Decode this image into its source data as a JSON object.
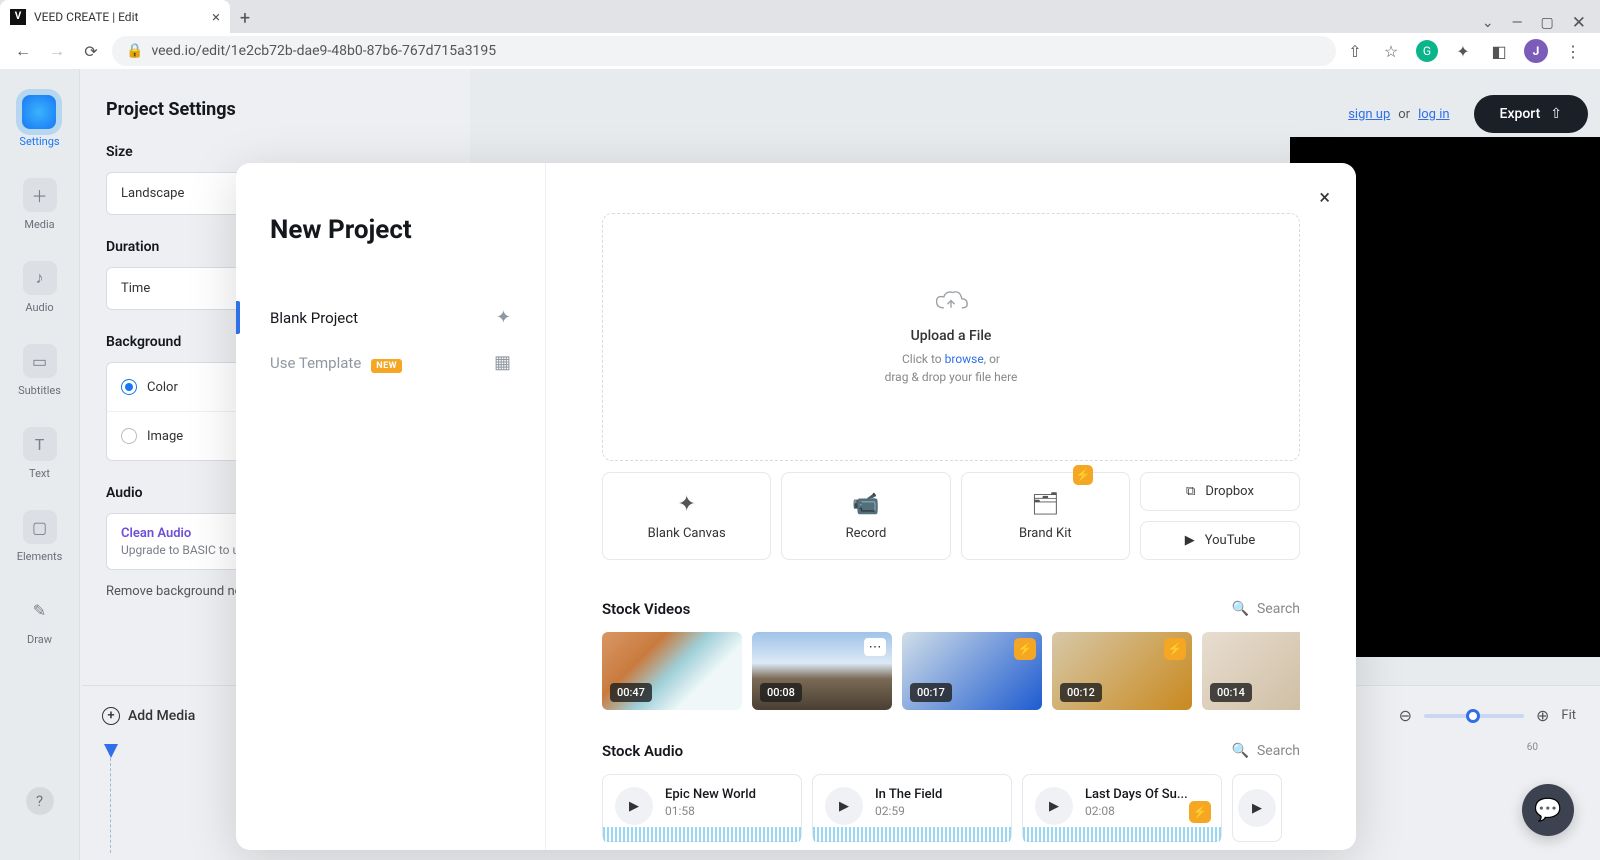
{
  "browser": {
    "tab_title": "VEED CREATE | Edit",
    "url": "veed.io/edit/1e2cb72b-dae9-48b0-87b6-767d715a3195",
    "avatar_initial": "J"
  },
  "top": {
    "signup": "sign up",
    "or": "or",
    "login": "log in",
    "export": "Export"
  },
  "rail": {
    "items": [
      "Settings",
      "Media",
      "Audio",
      "Subtitles",
      "Text",
      "Elements",
      "Draw"
    ]
  },
  "settings": {
    "heading": "Project Settings",
    "size_label": "Size",
    "size_value": "Landscape",
    "duration_label": "Duration",
    "duration_value": "Time",
    "background_label": "Background",
    "bg_color": "Color",
    "bg_image": "Image",
    "audio_label": "Audio",
    "clean_audio": "Clean Audio",
    "clean_sub": "Upgrade to BASIC to u",
    "remove_bg": "Remove background no"
  },
  "timeline": {
    "add_media": "Add Media",
    "fit": "Fit",
    "scale": "60"
  },
  "modal": {
    "title": "New Project",
    "blank": "Blank Project",
    "use_template": "Use Template",
    "new_badge": "NEW",
    "upload_title": "Upload a File",
    "upload_click": "Click to ",
    "upload_browse": "browse",
    "upload_or": ", or",
    "upload_drag": "drag & drop your file here",
    "sources": {
      "blank_canvas": "Blank Canvas",
      "record": "Record",
      "brand_kit": "Brand Kit",
      "dropbox": "Dropbox",
      "youtube": "YouTube"
    },
    "stock_videos": "Stock Videos",
    "stock_audio": "Stock Audio",
    "search": "Search",
    "videos": [
      {
        "time": "00:47"
      },
      {
        "time": "00:08"
      },
      {
        "time": "00:17"
      },
      {
        "time": "00:12"
      },
      {
        "time": "00:14"
      }
    ],
    "audio": [
      {
        "title": "Epic New World",
        "time": "01:58"
      },
      {
        "title": "In The Field",
        "time": "02:59"
      },
      {
        "title": "Last Days Of Su...",
        "time": "02:08"
      }
    ]
  }
}
